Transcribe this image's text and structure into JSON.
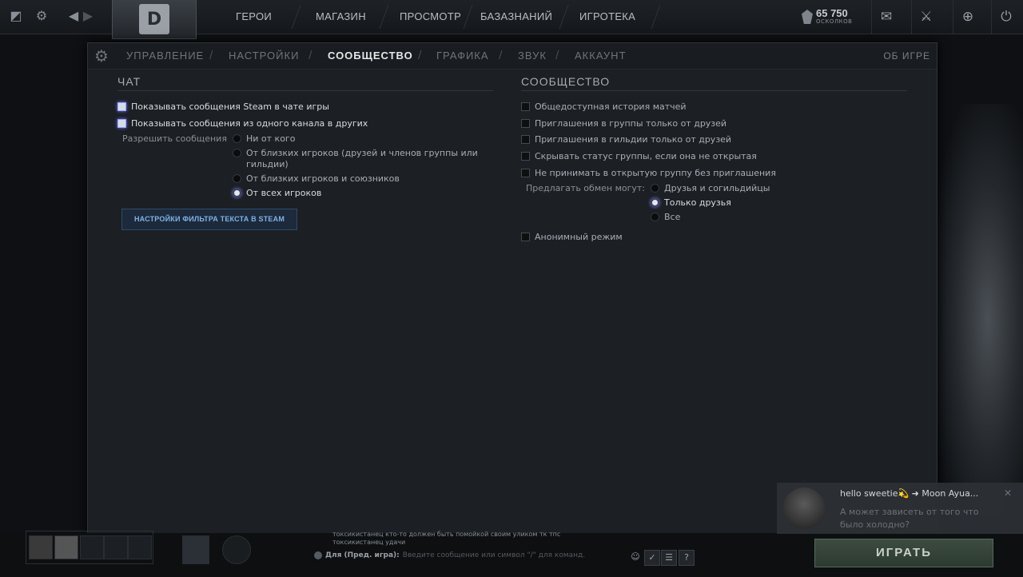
{
  "topbar": {
    "nav": [
      "ГЕРОИ",
      "МАГАЗИН",
      "ПРОСМОТР",
      "БАЗАЗНАНИЙ",
      "ИГРОТЕКА"
    ],
    "shards_value": "65 750",
    "shards_label": "ОСКОЛКОВ"
  },
  "settings": {
    "tabs": [
      "УПРАВЛЕНИЕ",
      "НАСТРОЙКИ",
      "СООБЩЕСТВО",
      "ГРАФИКА",
      "ЗВУК",
      "АККАУНТ"
    ],
    "active_tab": "СООБЩЕСТВО",
    "about": "ОБ ИГРЕ",
    "chat": {
      "title": "ЧАТ",
      "checkboxes": [
        {
          "label": "Показывать сообщения Steam в чате игры",
          "checked": true
        },
        {
          "label": "Показывать сообщения из одного канала в других",
          "checked": true
        }
      ],
      "allow_label": "Разрешить сообщения",
      "allow_options": [
        {
          "label": "Ни от кого",
          "selected": false
        },
        {
          "label": "От близких игроков (друзей и членов группы или",
          "label2": "гильдии)",
          "selected": false
        },
        {
          "label": "От близких игроков и союзников",
          "selected": false
        },
        {
          "label": "От всех игроков",
          "selected": true
        }
      ],
      "filter_button": "НАСТРОЙКИ ФИЛЬТРА ТЕКСТА В STEAM"
    },
    "community": {
      "title": "СООБЩЕСТВО",
      "checkboxes": [
        {
          "label": "Общедоступная история матчей",
          "checked": false
        },
        {
          "label": "Приглашения в группы только от друзей",
          "checked": false
        },
        {
          "label": "Приглашения в гильдии только от друзей",
          "checked": false
        },
        {
          "label": "Скрывать статус группы, если она не открытая",
          "checked": false
        },
        {
          "label": "Не принимать в открытую группу без приглашения",
          "checked": false
        }
      ],
      "trade_label": "Предлагать обмен могут:",
      "trade_options": [
        {
          "label": "Друзья и согильдийцы",
          "selected": false
        },
        {
          "label": "Только друзья",
          "selected": true
        },
        {
          "label": "Все",
          "selected": false
        }
      ],
      "anonymous": {
        "label": "Анонимный режим",
        "checked": false
      }
    }
  },
  "bottom": {
    "chat_line1": "токсикистанец   кто-то должен быть помойкой своим уликом тк тпс",
    "chat_line2": "токсикистанец   удачи",
    "chat_channel": "Для (Пред. игра):",
    "chat_placeholder": "Введите сообщение или символ \"/\" для команд.",
    "play": "ИГРАТЬ"
  },
  "notification": {
    "title": "hello sweetie💫 ➜ Moon Ayua...",
    "message": "А может зависеть от того что было холодно?"
  }
}
